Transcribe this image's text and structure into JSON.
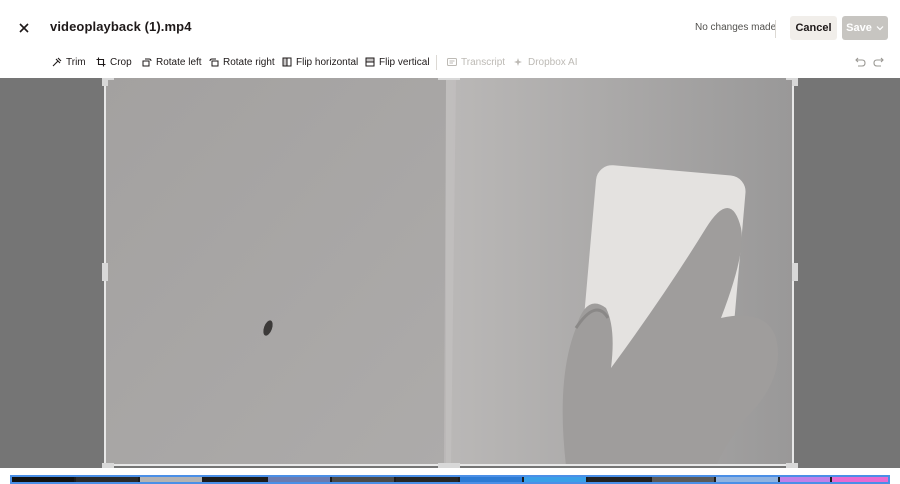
{
  "header": {
    "title": "videoplayback (1).mp4",
    "status": "No changes made",
    "cancel_label": "Cancel",
    "save_label": "Save",
    "close_icon": "close-icon"
  },
  "toolbar": {
    "tools": [
      {
        "label": "Trim",
        "icon": "trim-icon",
        "enabled": true
      },
      {
        "label": "Crop",
        "icon": "crop-icon",
        "enabled": true
      },
      {
        "label": "Rotate left",
        "icon": "rotate-left-icon",
        "enabled": true
      },
      {
        "label": "Rotate right",
        "icon": "rotate-right-icon",
        "enabled": true
      },
      {
        "label": "Flip horizontal",
        "icon": "flip-horizontal-icon",
        "enabled": true
      },
      {
        "label": "Flip vertical",
        "icon": "flip-vertical-icon",
        "enabled": true
      },
      {
        "label": "Transcript",
        "icon": "transcript-icon",
        "enabled": false
      },
      {
        "label": "Dropbox AI",
        "icon": "sparkle-icon",
        "enabled": false
      }
    ],
    "undo_icon": "undo-icon",
    "redo_icon": "redo-icon"
  },
  "colors": {
    "accent": "#4a8fe7",
    "cancel_bg": "#f1eeea",
    "save_bg": "#c7c5c1",
    "canvas_bg": "#757575"
  }
}
